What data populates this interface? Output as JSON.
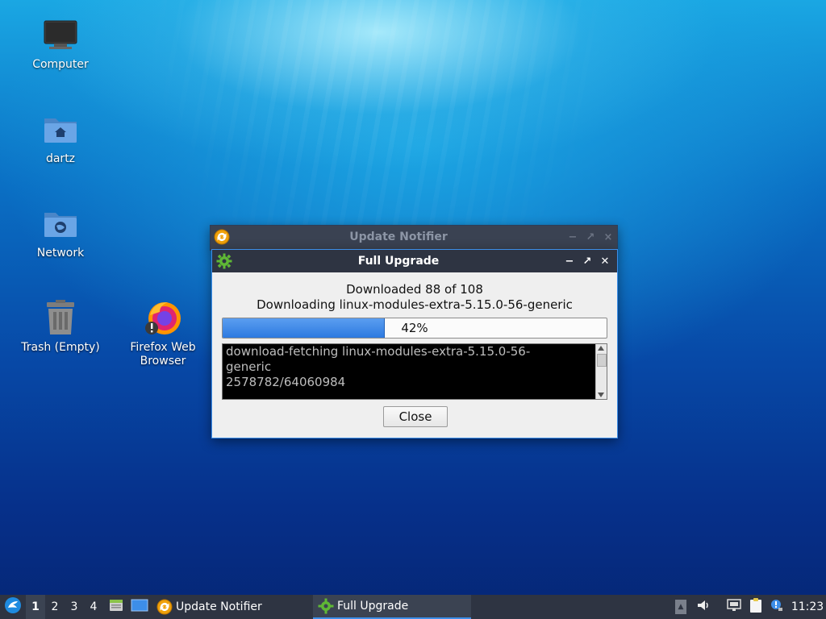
{
  "desktop": {
    "icons": [
      {
        "label": "Computer"
      },
      {
        "label": "dartz"
      },
      {
        "label": "Network"
      },
      {
        "label": "Trash (Empty)"
      },
      {
        "label_line1": "Firefox Web",
        "label_line2": "Browser"
      }
    ]
  },
  "update_notifier_window": {
    "title": "Update Notifier",
    "controls": {
      "minimize": "−",
      "maximize": "↗",
      "close": "×"
    }
  },
  "full_upgrade_window": {
    "title": "Full Upgrade",
    "controls": {
      "minimize": "−",
      "maximize": "↗",
      "close": "✕"
    },
    "status_line1": "Downloaded 88 of 108",
    "status_line2": "Downloading linux-modules-extra-5.15.0-56-generic",
    "progress": {
      "percent": 42,
      "label": "42%"
    },
    "log": {
      "line1": "download-fetching linux-modules-extra-5.15.0-56-",
      "line2": "generic",
      "line3": "2578782/64060984"
    },
    "close_button": "Close"
  },
  "taskbar": {
    "workspaces": [
      "1",
      "2",
      "3",
      "4"
    ],
    "active_workspace": "1",
    "tasks": [
      {
        "label": "Update Notifier",
        "icon": "update-icon"
      },
      {
        "label": "Full Upgrade",
        "icon": "gear-icon",
        "active": true
      }
    ],
    "clock": "11:23"
  },
  "colors": {
    "accent": "#3d8ee8",
    "taskbar": "#2e3442",
    "titlebar": "#2e3442"
  }
}
